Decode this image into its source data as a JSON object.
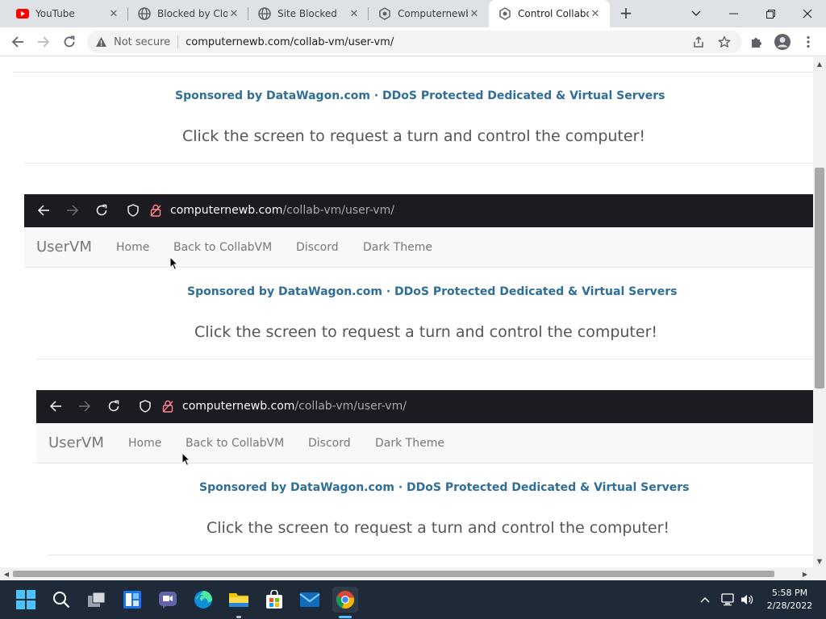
{
  "tabs": [
    {
      "title": "YouTube",
      "icon": "youtube-icon"
    },
    {
      "title": "Blocked by Clou",
      "icon": "globe-icon"
    },
    {
      "title": "Site Blocked",
      "icon": "globe-icon"
    },
    {
      "title": "Computernewb",
      "icon": "collabvm-icon"
    },
    {
      "title": "Control Collabo",
      "icon": "collabvm-icon",
      "active": true
    }
  ],
  "toolbar": {
    "security_label": "Not secure",
    "url": "computernewb.com/collab-vm/user-vm/"
  },
  "page": {
    "sponsor_text": "Sponsored by DataWagon.com · DDoS Protected Dedicated & Virtual Servers",
    "cta_text": "Click the screen to request a turn and control the computer!",
    "vm_url_host": "computernewb.com",
    "vm_url_path": "/collab-vm/user-vm/",
    "navbar": {
      "brand": "UserVM",
      "links": [
        "Home",
        "Back to CollabVM",
        "Discord",
        "Dark Theme"
      ]
    }
  },
  "taskbar": {
    "apps": [
      "start-icon",
      "search-icon",
      "task-view-icon",
      "widgets-icon",
      "teams-chat-icon",
      "edge-icon",
      "file-explorer-icon",
      "store-icon",
      "mail-icon",
      "chrome-icon"
    ],
    "time": "5:58 PM",
    "date": "2/28/2022"
  },
  "colors": {
    "sponsor": "#2e6e97",
    "dark_bar": "#1c1b22",
    "taskbar": "#1f2a38",
    "tab_strip": "#dee1e6"
  }
}
